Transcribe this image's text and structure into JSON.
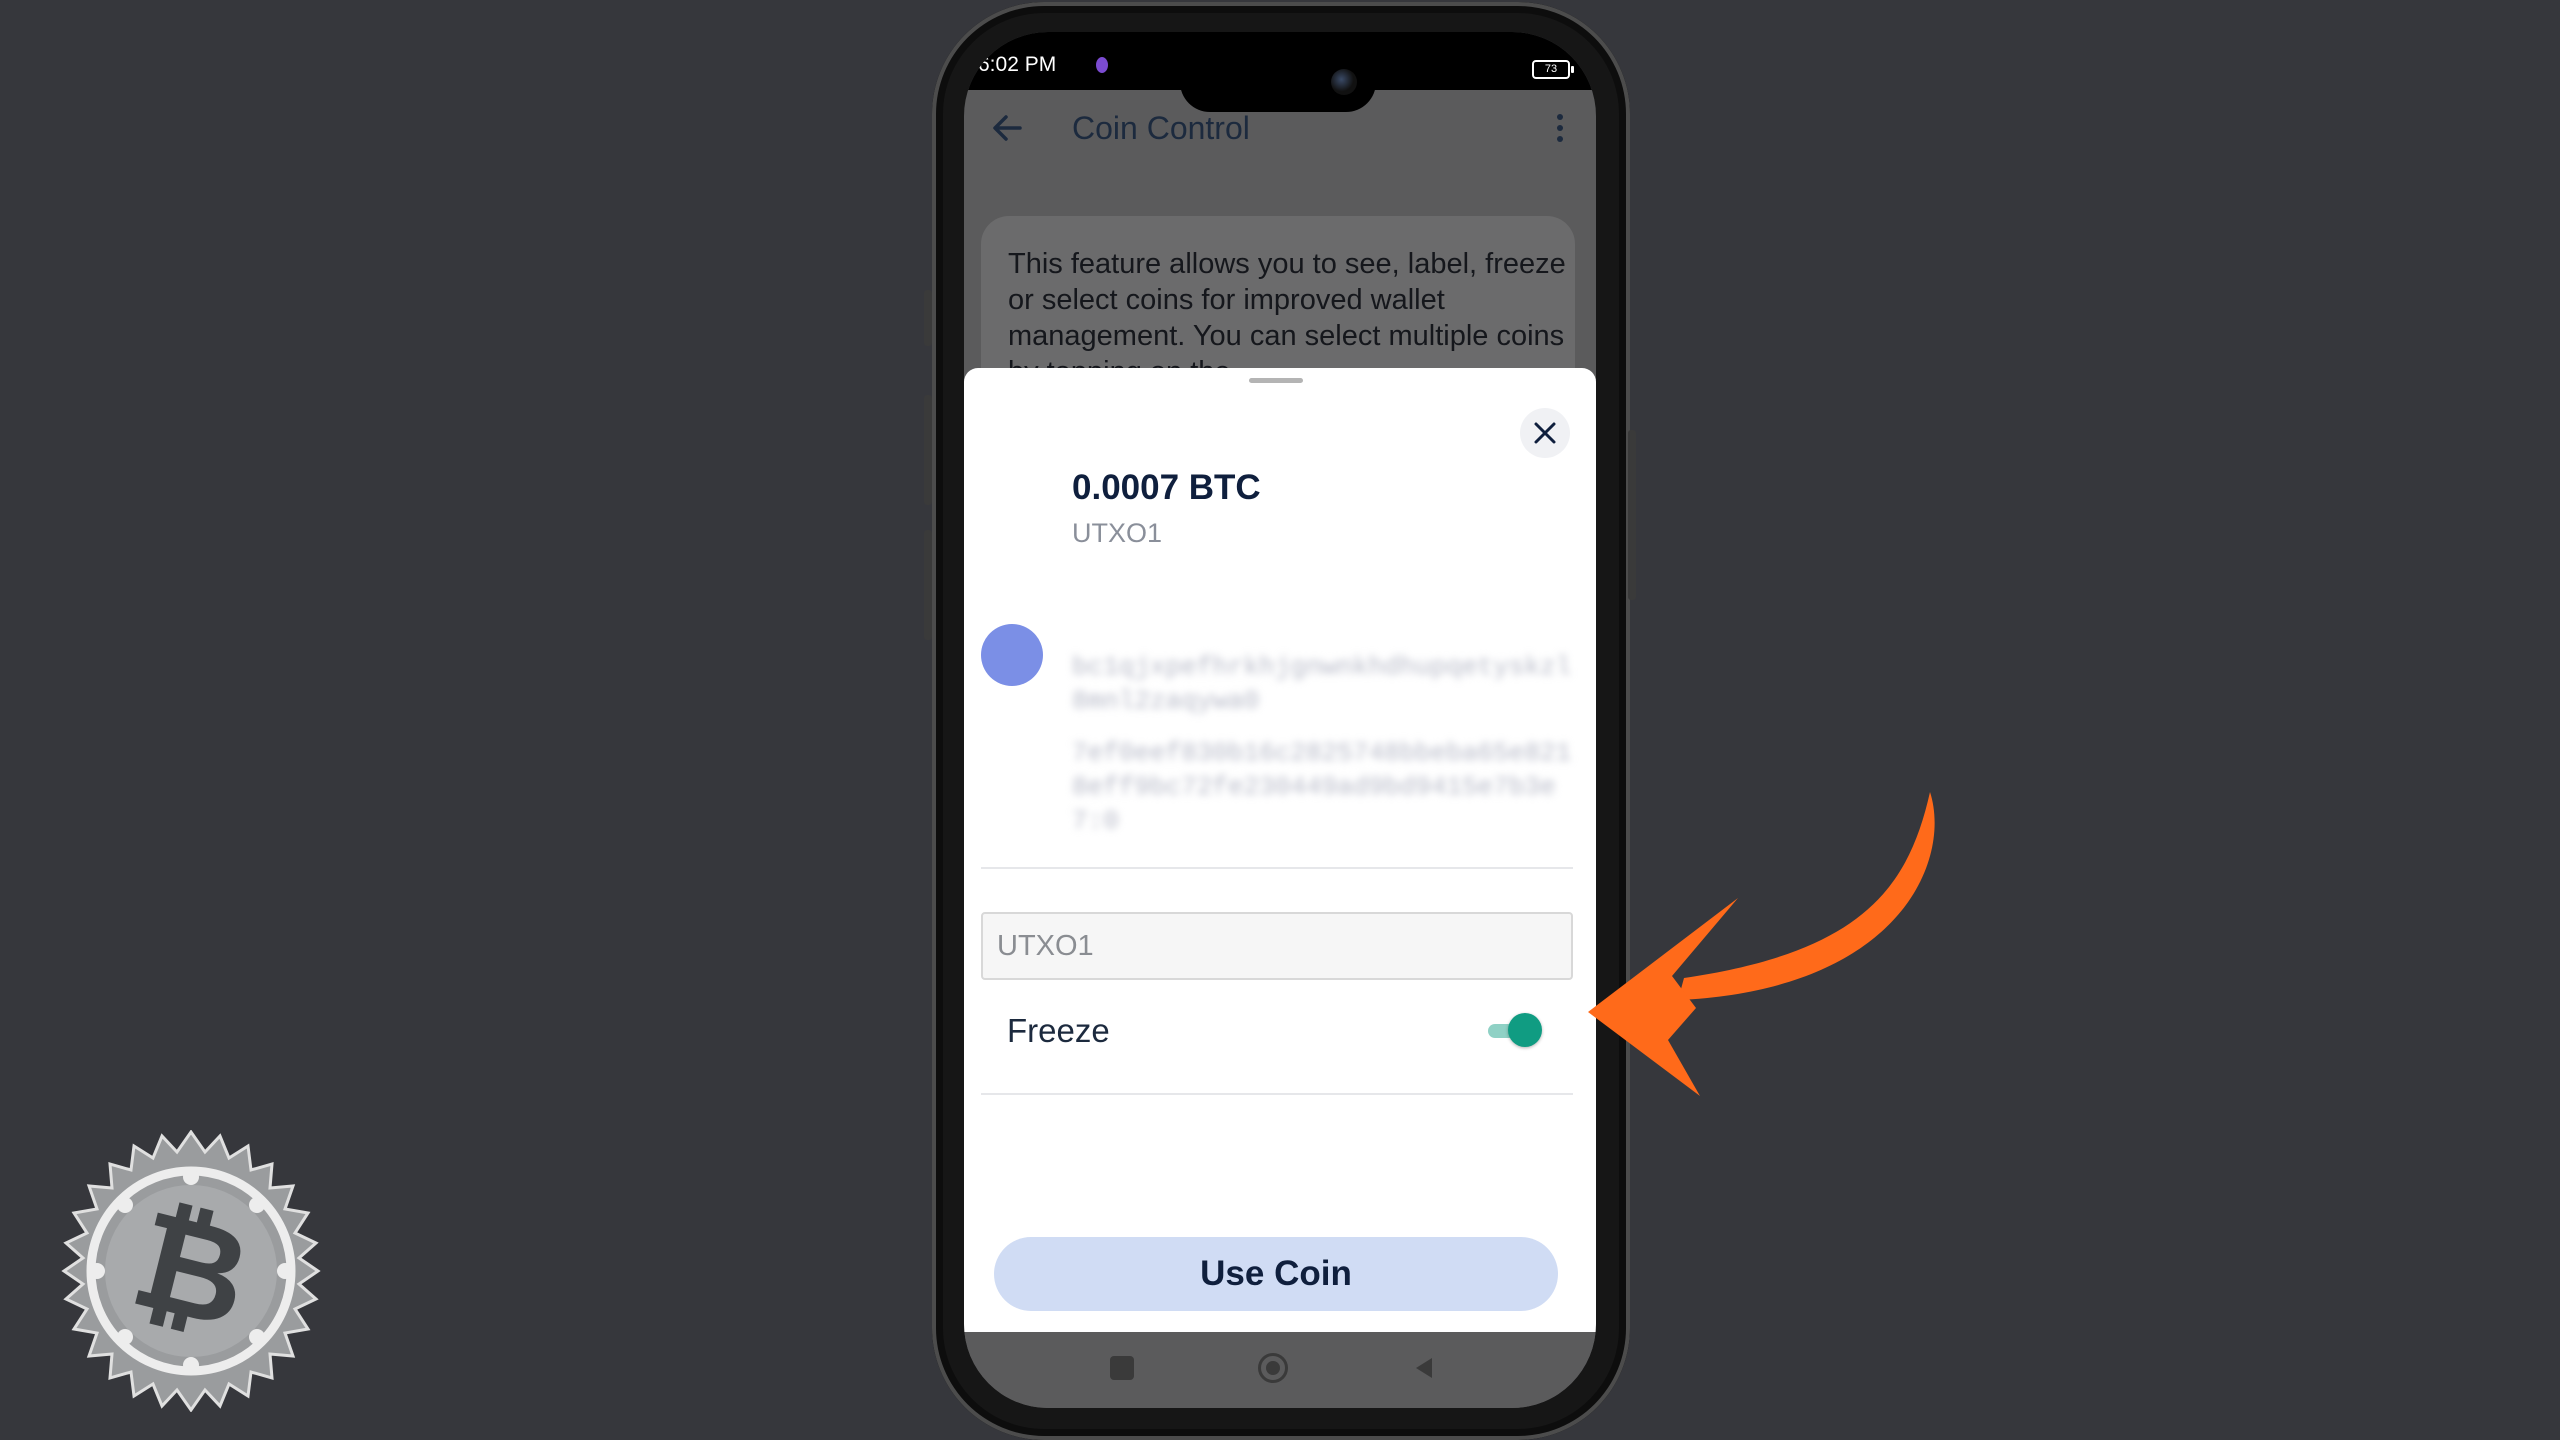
{
  "status_bar": {
    "time": "6:02 PM",
    "battery": "73"
  },
  "app_bar": {
    "title": "Coin Control"
  },
  "info_card": {
    "text": "This feature allows you to see, label, freeze or select coins for improved wallet management. You can select multiple coins by tapping on the"
  },
  "sheet": {
    "amount": "0.0007 BTC",
    "label": "UTXO1",
    "address_blurred": "bc1qjxpefhrkhjgnwnkhdhupqetyskzl8mnl2zaqywa0",
    "txid_blurred": "7ef0eef830b16c2825748bbeba65e8218eff9bc72fe230449ad9bd9415e7b3e7:0",
    "label_input_value": "UTXO1",
    "freeze_label": "Freeze",
    "freeze_on": true,
    "use_coin_label": "Use Coin"
  },
  "colors": {
    "background": "#36373c",
    "accent_toggle": "#109c82",
    "button_bg": "#d0dcf4",
    "annotation_arrow": "#ff6a1a"
  },
  "icons": {
    "back": "arrow-left-icon",
    "more": "more-vertical-icon",
    "close": "close-icon",
    "logo": "bitcoin-badge-logo",
    "annotation": "curved-arrow"
  }
}
